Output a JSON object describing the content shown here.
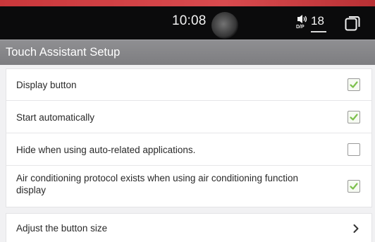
{
  "status_bar": {
    "time": "10:08",
    "audio_mode_label": "D/P",
    "temperature": "18",
    "speaker_icon": "speaker-icon",
    "windows_icon": "recent-apps-icon"
  },
  "header": {
    "title": "Touch Assistant Setup"
  },
  "settings": {
    "items": [
      {
        "label": "Display button",
        "checked": true
      },
      {
        "label": "Start automatically",
        "checked": true
      },
      {
        "label": "Hide when using auto-related applications.",
        "checked": false
      },
      {
        "label": "Air conditioning protocol exists when using air conditioning function display",
        "checked": true
      }
    ]
  },
  "nav": {
    "adjust_size_label": "Adjust the button size",
    "chevron_icon": "chevron-right-icon"
  },
  "colors": {
    "status_bar_bg": "#0b0b0c",
    "title_bar_bg": "#858588",
    "check_color": "#7cc04b",
    "accent": "#c9373b"
  }
}
